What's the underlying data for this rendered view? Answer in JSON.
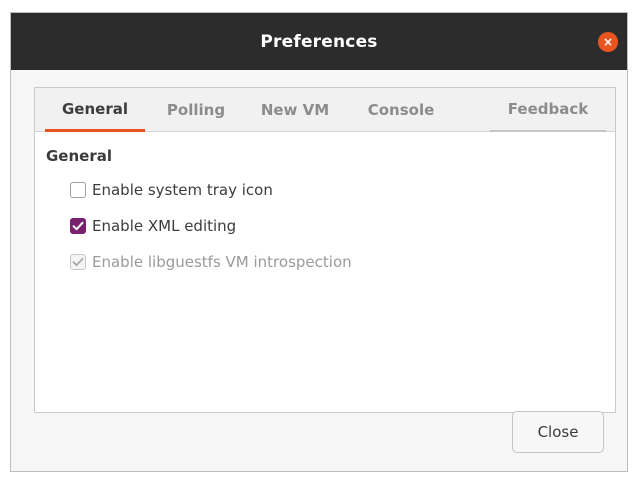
{
  "window": {
    "title": "Preferences",
    "close_icon_glyph": "×"
  },
  "tabs": [
    {
      "label": "General",
      "active": true
    },
    {
      "label": "Polling",
      "active": false
    },
    {
      "label": "New VM",
      "active": false
    },
    {
      "label": "Console",
      "active": false
    },
    {
      "label": "Feedback",
      "active": false
    }
  ],
  "general": {
    "section_title": "General",
    "options": [
      {
        "label": "Enable system tray icon",
        "checked": false,
        "enabled": true
      },
      {
        "label": "Enable XML editing",
        "checked": true,
        "enabled": true
      },
      {
        "label": "Enable libguestfs VM introspection",
        "checked": true,
        "enabled": false
      }
    ]
  },
  "footer": {
    "close_label": "Close"
  },
  "colors": {
    "accent": "#e9541f",
    "checkbox_checked": "#77216f",
    "titlebar": "#2c2c2c"
  },
  "icons": {
    "window_close": "close-icon",
    "checkmark": "checkmark-icon"
  }
}
